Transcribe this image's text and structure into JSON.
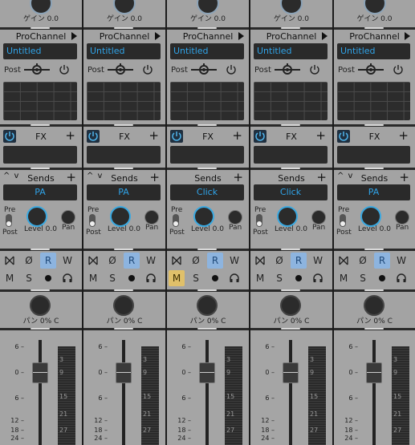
{
  "strips": [
    {
      "gain_label": "ゲイン 0.0",
      "prochannel": "ProChannel",
      "name": "Untitled",
      "post": "Post",
      "fx": "FX",
      "sends": "Sends",
      "sends_arrows": "^ v",
      "bus": "PA",
      "pre": "Pre",
      "post_b": "Post",
      "level": "Level 0.0",
      "pan": "Pan",
      "mute_active": false,
      "pan_value": "パン 0% C"
    },
    {
      "gain_label": "ゲイン 0.0",
      "prochannel": "ProChannel",
      "name": "Untitled",
      "post": "Post",
      "fx": "FX",
      "sends": "Sends",
      "sends_arrows": "^ v",
      "bus": "PA",
      "pre": "Pre",
      "post_b": "Post",
      "level": "Level 0.0",
      "pan": "Pan",
      "mute_active": false,
      "pan_value": "パン 0% C"
    },
    {
      "gain_label": "ゲイン 0.0",
      "prochannel": "ProChannel",
      "name": "Untitled",
      "post": "Post",
      "fx": "FX",
      "sends": "Sends",
      "sends_arrows": "",
      "bus": "Click",
      "pre": "Pre",
      "post_b": "Post",
      "level": "Level 0.0",
      "pan": "Pan",
      "mute_active": true,
      "pan_value": "パン 0% C"
    },
    {
      "gain_label": "ゲイン 0.0",
      "prochannel": "ProChannel",
      "name": "Untitled",
      "post": "Post",
      "fx": "FX",
      "sends": "Sends",
      "sends_arrows": "",
      "bus": "Click",
      "pre": "Pre",
      "post_b": "Post",
      "level": "Level 0.0",
      "pan": "Pan",
      "mute_active": false,
      "pan_value": "パン 0% C"
    },
    {
      "gain_label": "ゲイン 0.0",
      "prochannel": "ProChannel",
      "name": "Untitled",
      "post": "Post",
      "fx": "FX",
      "sends": "Sends",
      "sends_arrows": "^ v",
      "bus": "PA",
      "pre": "Pre",
      "post_b": "Post",
      "level": "Level 0.0",
      "pan": "Pan",
      "mute_active": false,
      "pan_value": "パン 0% C"
    }
  ],
  "buttons": {
    "phase_icon": "bowtie-icon",
    "invert": "Ø",
    "read": "R",
    "write": "W",
    "mute": "M",
    "solo": "S",
    "record_icon": "record-icon",
    "monitor_icon": "headphones-icon"
  },
  "fader_scale": [
    "6 –",
    "0 –",
    "6 –",
    "12 –",
    "18 –",
    "24 –"
  ],
  "meter_scale": [
    "3",
    "9",
    "15",
    "21",
    "27"
  ],
  "fx_plus": "+",
  "sends_plus": "+",
  "colors": {
    "read_active": "#8db4df",
    "mute_active": "#e0c06a",
    "name_text": "#2fa3e8"
  }
}
